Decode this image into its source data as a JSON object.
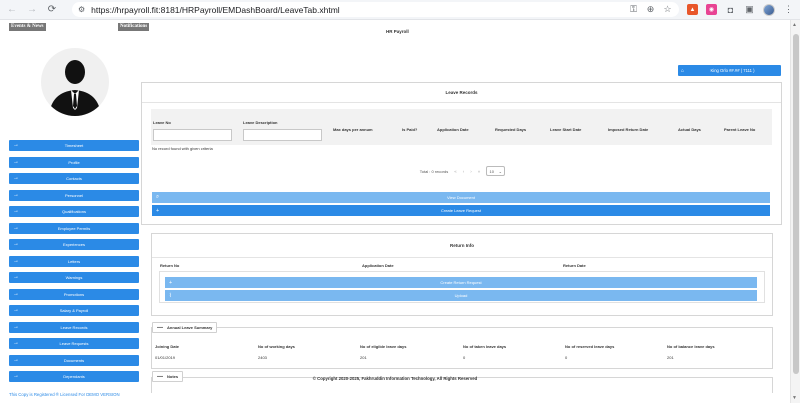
{
  "browser": {
    "url": "https://hrpayroll.fit:8181/HRPayroll/EMDashBoard/LeaveTab.xhtml",
    "back_icon": "arrow-left-icon",
    "forward_icon": "arrow-right-icon",
    "reload_icon": "reload-icon"
  },
  "header": {
    "tags": [
      "Events & News",
      "Notifications"
    ],
    "title": "HR Payroll"
  },
  "user": {
    "label": "King Orlo ##.## ( 7111 )"
  },
  "sidebar": {
    "items": [
      {
        "label": "Timesheet"
      },
      {
        "label": "Profile"
      },
      {
        "label": "Contacts"
      },
      {
        "label": "Personnel"
      },
      {
        "label": "Qualifications"
      },
      {
        "label": "Employee Permits"
      },
      {
        "label": "Experiences"
      },
      {
        "label": "Letters"
      },
      {
        "label": "Warnings"
      },
      {
        "label": "Promotions"
      },
      {
        "label": "Salary & Payroll"
      },
      {
        "label": "Leave Records"
      },
      {
        "label": "Leave Requests"
      },
      {
        "label": "Documents"
      },
      {
        "label": "Dependants"
      }
    ]
  },
  "leave_records": {
    "title": "Leave Records",
    "columns": [
      "Leave No",
      "Leave Description",
      "Max days per annum",
      "Is Paid?",
      "Application Date",
      "Requested Days",
      "Leave Start Date",
      "Imposed Return Date",
      "Actual Days",
      "Parent Leave No"
    ],
    "empty_message": "No record found with given criteria",
    "pager": {
      "total": "Total : 0 records",
      "first": "«",
      "prev": "‹",
      "next": "›",
      "last": "»",
      "page_size": "10"
    }
  },
  "actions": {
    "view_document": "View Document",
    "create_leave_request": "Create Leave Request"
  },
  "return_info": {
    "title": "Return Info",
    "columns": [
      "Return No",
      "Application Date",
      "Return Date"
    ],
    "create_return_request": "Create Return Request",
    "upload": "Upload"
  },
  "annual_summary": {
    "legend": "Annual Leave Summary",
    "columns": [
      "Joining Date",
      "No of working days",
      "No of eligible leave days",
      "No of taken leave days",
      "No of reserved leave days",
      "No of balance leave days"
    ],
    "values": [
      "01/01/2019",
      "2403",
      "201",
      "0",
      "0",
      "201"
    ]
  },
  "notes": {
    "legend": "Notes"
  },
  "footer": {
    "copyright": "© Copyright 2020-2025, Fakhruddin Information Technology, All Rights Reserved",
    "registered": "This Copy is Registered ® Licensed For DEMO VERSION"
  }
}
